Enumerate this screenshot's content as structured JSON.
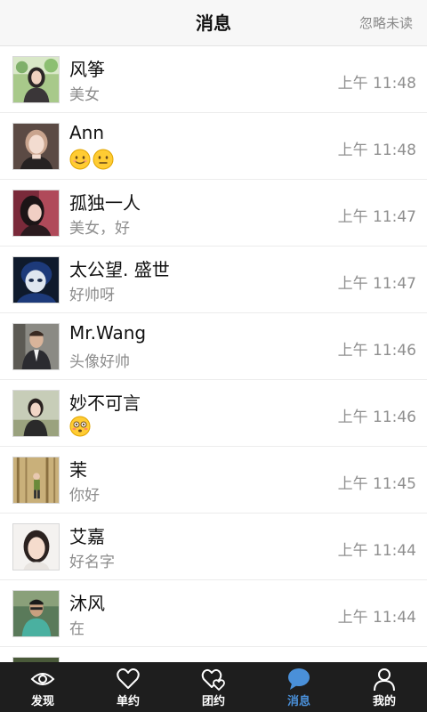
{
  "header": {
    "title": "消息",
    "ignore_unread": "忽略未读"
  },
  "messages": [
    {
      "name": "风筝",
      "preview": "美女",
      "time": "上午 11:48",
      "avatar": "avatar-photo-woman"
    },
    {
      "name": "Ann",
      "preview": "",
      "emojis": [
        "smiling-face-emoji",
        "neutral-face-emoji"
      ],
      "time": "上午 11:48",
      "avatar": "avatar-photo-woman"
    },
    {
      "name": "孤独一人",
      "preview": "美女，好",
      "time": "上午 11:47",
      "avatar": "avatar-photo-woman"
    },
    {
      "name": "太公望. 盛世",
      "preview": "好帅呀",
      "time": "上午 11:47",
      "avatar": "avatar-photo-anime"
    },
    {
      "name": "Mr.Wang",
      "preview": "头像好帅",
      "time": "上午 11:46",
      "avatar": "avatar-photo-man"
    },
    {
      "name": "妙不可言",
      "preview": "",
      "emojis": [
        "flushed-face-emoji"
      ],
      "time": "上午 11:46",
      "avatar": "avatar-photo-woman"
    },
    {
      "name": "茉",
      "preview": "你好",
      "time": "上午 11:45",
      "avatar": "avatar-photo-woman"
    },
    {
      "name": "艾嘉",
      "preview": "好名字",
      "time": "上午 11:44",
      "avatar": "avatar-photo-woman"
    },
    {
      "name": "沐风",
      "preview": "在",
      "time": "上午 11:44",
      "avatar": "avatar-photo-man"
    }
  ],
  "tabs": [
    {
      "label": "发现",
      "icon": "eye-icon",
      "active": false
    },
    {
      "label": "单约",
      "icon": "heart-icon",
      "active": false
    },
    {
      "label": "团约",
      "icon": "double-heart-icon",
      "active": false
    },
    {
      "label": "消息",
      "icon": "chat-bubble-icon",
      "active": true
    },
    {
      "label": "我的",
      "icon": "person-icon",
      "active": false
    }
  ],
  "colors": {
    "accent": "#4a90d9",
    "tabbar_bg": "#1e1e1e",
    "header_bg": "#f7f7f7"
  }
}
